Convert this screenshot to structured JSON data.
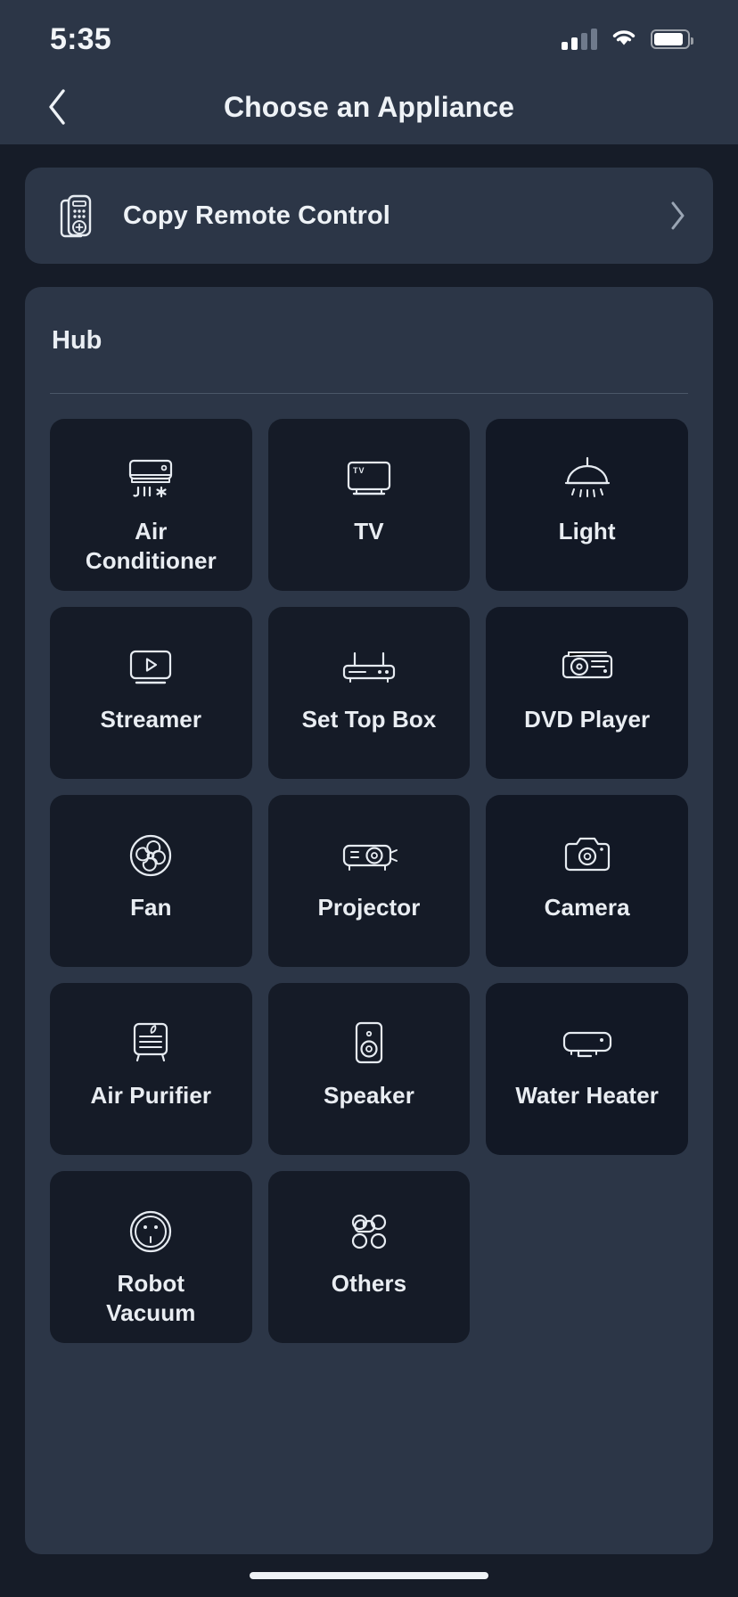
{
  "status_bar": {
    "time": "5:35",
    "signal_icon": "cellular-signal-icon",
    "signal_bars_filled": 2,
    "signal_bars_total": 4,
    "wifi_icon": "wifi-icon",
    "battery_icon": "battery-icon",
    "battery_level_pct": 88
  },
  "nav": {
    "back_icon": "chevron-left-icon",
    "title": "Choose an Appliance"
  },
  "copy_remote": {
    "icon": "remote-control-icon",
    "label": "Copy Remote Control",
    "chevron_icon": "chevron-right-icon"
  },
  "hub": {
    "title": "Hub",
    "appliances": [
      {
        "label": "Air\nConditioner",
        "label_line1": "Air",
        "label_line2": "Conditioner",
        "icon": "air-conditioner-icon"
      },
      {
        "label": "TV",
        "icon": "tv-icon"
      },
      {
        "label": "Light",
        "icon": "ceiling-light-icon"
      },
      {
        "label": "Streamer",
        "icon": "streamer-icon"
      },
      {
        "label": "Set Top Box",
        "icon": "set-top-box-icon"
      },
      {
        "label": "DVD Player",
        "icon": "dvd-player-icon"
      },
      {
        "label": "Fan",
        "icon": "fan-icon"
      },
      {
        "label": "Projector",
        "icon": "projector-icon"
      },
      {
        "label": "Camera",
        "icon": "camera-icon"
      },
      {
        "label": "Air Purifier",
        "icon": "air-purifier-icon"
      },
      {
        "label": "Speaker",
        "icon": "speaker-icon"
      },
      {
        "label": "Water Heater",
        "icon": "water-heater-icon"
      },
      {
        "label": "Robot\nVacuum",
        "label_line1": "Robot",
        "label_line2": "Vacuum",
        "icon": "robot-vacuum-icon"
      },
      {
        "label": "Others",
        "icon": "others-grid-icon"
      }
    ]
  },
  "home_indicator": "home-indicator",
  "colors": {
    "page_background": "#161c28",
    "bar_background": "#2c3647",
    "card_background": "#2c3647",
    "tile_background": "#151b27",
    "text_primary": "#eef2f6",
    "divider": "#4a5668",
    "icon_stroke": "#e6ebf1"
  }
}
